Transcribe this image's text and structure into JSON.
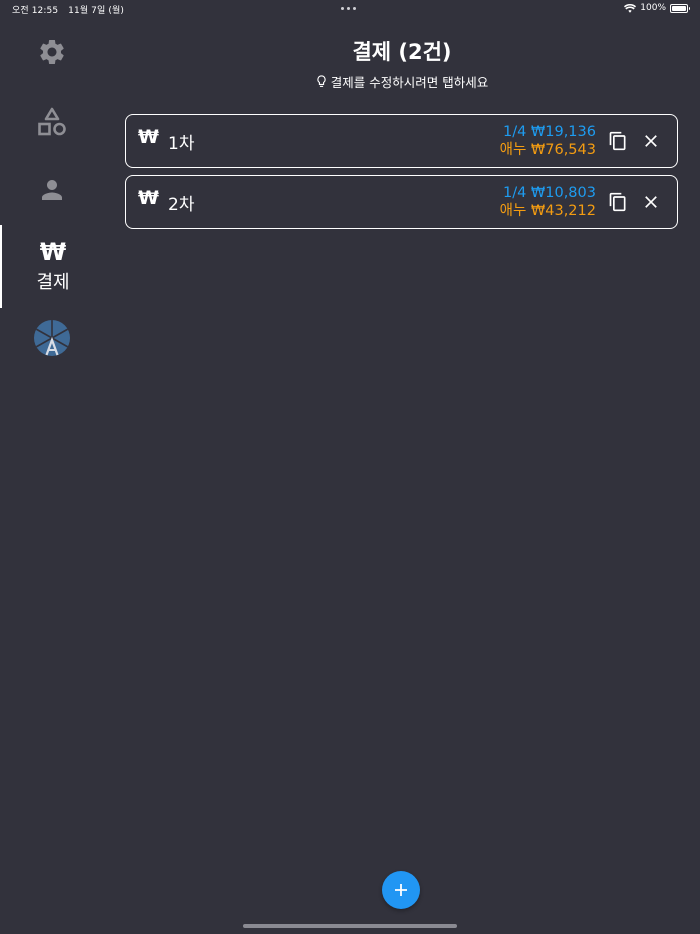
{
  "status_bar": {
    "time": "오전 12:55",
    "date": "11월 7일 (월)",
    "battery": "100%"
  },
  "rail": {
    "items": [
      {
        "icon": "gear-icon",
        "active": false
      },
      {
        "icon": "shapes-icon",
        "active": false
      },
      {
        "icon": "person-icon",
        "active": false
      },
      {
        "icon": "won-icon",
        "label": "결제",
        "active": true
      },
      {
        "icon": "avatar-logo",
        "active": false
      }
    ]
  },
  "header": {
    "title": "결제 (2건)",
    "hint": "결제를 수정하시려면 탭하세요"
  },
  "payments": [
    {
      "currency_symbol": "₩",
      "name": "1차",
      "line1": "1/4 ₩19,136",
      "line2": "애누 ₩76,543"
    },
    {
      "currency_symbol": "₩",
      "name": "2차",
      "line1": "1/4 ₩10,803",
      "line2": "애누 ₩43,212"
    }
  ],
  "fab": {
    "label": "+",
    "color": "#2196f3"
  },
  "colors": {
    "background": "#32323c",
    "per_person_amount": "#1e9cf0",
    "total_amount": "#f39c12"
  }
}
